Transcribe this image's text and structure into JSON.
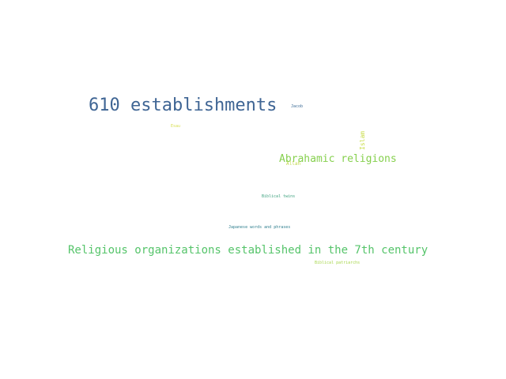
{
  "words": [
    {
      "text": "610 establishments",
      "color": "#3f6594"
    },
    {
      "text": "Religious organizations established in the 7th century",
      "color": "#55c46a"
    },
    {
      "text": "Abrahamic religions",
      "color": "#86d04e"
    },
    {
      "text": "Jacob",
      "color": "#3c6b96"
    },
    {
      "text": "Esau",
      "color": "#d6de4a"
    },
    {
      "text": "Islam",
      "color": "#c8dc47"
    },
    {
      "text": "Allah",
      "color": "#c2d84a"
    },
    {
      "text": "Biblical twins",
      "color": "#3aa07c"
    },
    {
      "text": "Japanese words and phrases",
      "color": "#2f7f8e"
    },
    {
      "text": "Biblical patriarchs",
      "color": "#a6d64a"
    }
  ]
}
